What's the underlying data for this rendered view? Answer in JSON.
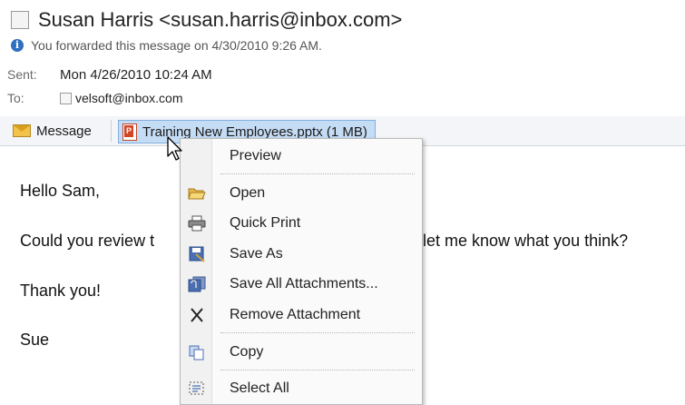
{
  "header": {
    "sender": "Susan Harris <susan.harris@inbox.com>",
    "info": "You forwarded this message on 4/30/2010 9:26 AM.",
    "sent_label": "Sent:",
    "sent_value": "Mon 4/26/2010 10:24 AM",
    "to_label": "To:",
    "to_value": "velsoft@inbox.com"
  },
  "attachments": {
    "message_tab": "Message",
    "file": "Training New Employees.pptx (1 MB)"
  },
  "body": {
    "greeting": "Hello Sam,",
    "line1_left": "Could you review t",
    "line1_right": "let me know what you think?",
    "thanks": "Thank you!",
    "signature": "Sue"
  },
  "context_menu": {
    "items": [
      {
        "label": "Preview",
        "icon": "none"
      },
      {
        "label": "Open",
        "icon": "folder-open-icon"
      },
      {
        "label": "Quick Print",
        "icon": "printer-icon"
      },
      {
        "label": "Save As",
        "icon": "save-as-icon"
      },
      {
        "label": "Save All Attachments...",
        "icon": "save-all-icon"
      },
      {
        "label": "Remove Attachment",
        "icon": "close-x-icon"
      },
      {
        "label": "Copy",
        "icon": "copy-icon"
      },
      {
        "label": "Select All",
        "icon": "select-all-icon"
      }
    ]
  },
  "colors": {
    "selection": "#c5dcf5",
    "info_icon": "#2f6fc0",
    "ppt": "#d24625"
  }
}
